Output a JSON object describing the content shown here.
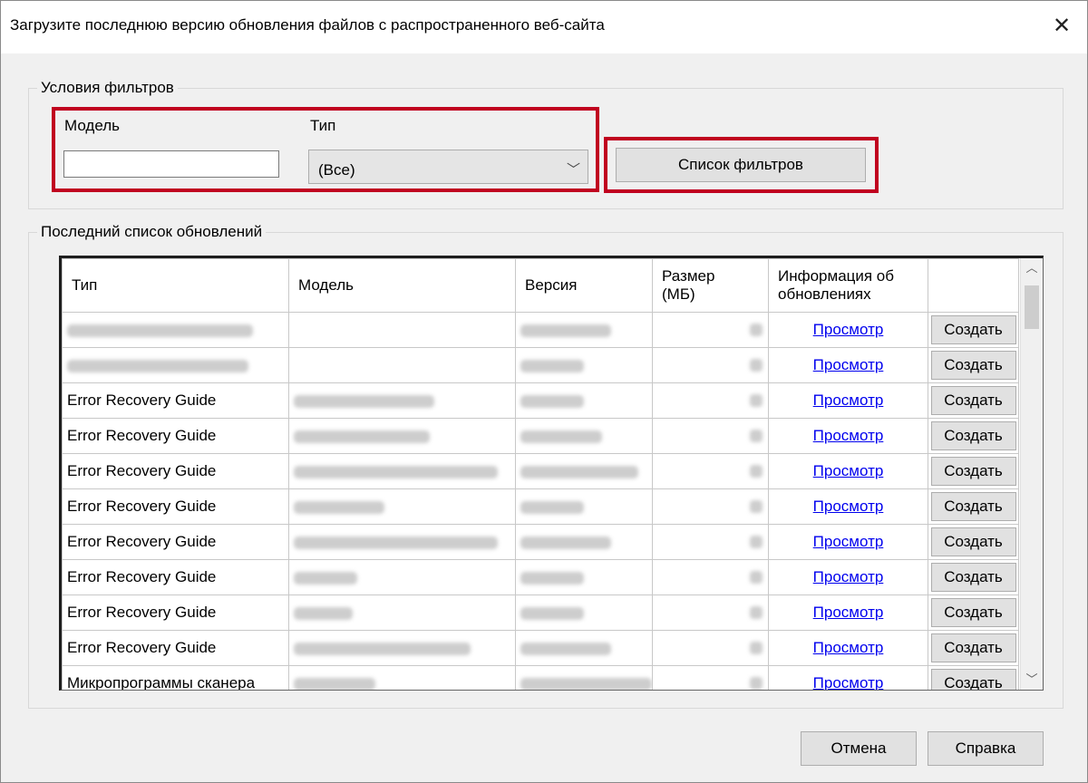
{
  "dialog": {
    "title": "Загрузите последнюю версию обновления файлов с распространенного веб-сайта",
    "close_label": "✕"
  },
  "filters": {
    "group_label": "Условия фильтров",
    "model_label": "Модель",
    "model_value": "",
    "type_label": "Тип",
    "type_selected": "(Все)",
    "filter_button": "Список фильтров"
  },
  "updates": {
    "group_label": "Последний список обновлений",
    "columns": [
      "Тип",
      "Модель",
      "Версия",
      "Размер\n(МБ)",
      "Информация об\nобновлениях",
      ""
    ],
    "view_link": "Просмотр",
    "create_button": "Создать",
    "rows": [
      {
        "type": ""
      },
      {
        "type": ""
      },
      {
        "type": "Error Recovery Guide"
      },
      {
        "type": "Error Recovery Guide"
      },
      {
        "type": "Error Recovery Guide"
      },
      {
        "type": "Error Recovery Guide"
      },
      {
        "type": "Error Recovery Guide"
      },
      {
        "type": "Error Recovery Guide"
      },
      {
        "type": "Error Recovery Guide"
      },
      {
        "type": "Error Recovery Guide"
      },
      {
        "type": "Микропрограммы сканера"
      }
    ]
  },
  "footer": {
    "cancel_button": "Отмена",
    "help_button": "Справка"
  },
  "colors": {
    "highlight": "#c0001f",
    "link": "#0000ee"
  }
}
